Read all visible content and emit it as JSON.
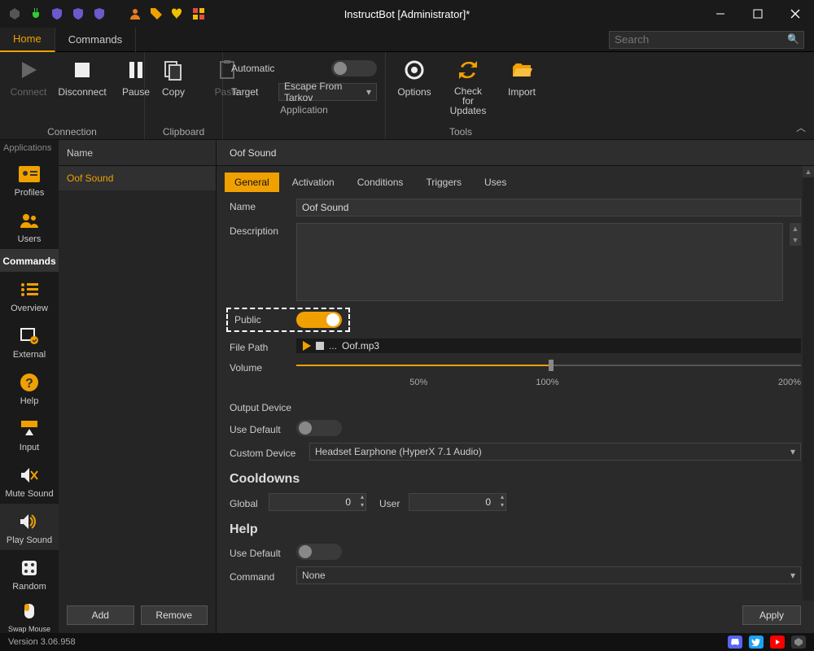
{
  "window": {
    "title": "InstructBot [Administrator]*"
  },
  "toptabs": {
    "items": [
      "Home",
      "Commands"
    ],
    "active": "Home"
  },
  "search": {
    "placeholder": "Search"
  },
  "ribbon": {
    "connection": {
      "label": "Connection",
      "connect": "Connect",
      "disconnect": "Disconnect",
      "pause": "Pause"
    },
    "clipboard": {
      "label": "Clipboard",
      "copy": "Copy",
      "paste": "Paste"
    },
    "application": {
      "label": "Application",
      "automatic": "Automatic",
      "automatic_on": false,
      "target_label": "Target",
      "target_value": "Escape From Tarkov"
    },
    "tools": {
      "label": "Tools",
      "options": "Options",
      "check": "Check for Updates",
      "import": "Import"
    }
  },
  "sidebar": {
    "section": "Applications",
    "items": [
      {
        "label": "Profiles"
      },
      {
        "label": "Users"
      },
      {
        "label": "Commands"
      },
      {
        "label": "Overview"
      },
      {
        "label": "External"
      },
      {
        "label": "Help"
      },
      {
        "label": "Input"
      },
      {
        "label": "Mute Sound"
      },
      {
        "label": "Play Sound"
      },
      {
        "label": "Random"
      },
      {
        "label": "Swap Mouse Button"
      }
    ]
  },
  "col2": {
    "header": "Name",
    "items": [
      "Oof Sound"
    ],
    "add": "Add",
    "remove": "Remove"
  },
  "detail": {
    "title": "Oof Sound",
    "tabs": [
      "General",
      "Activation",
      "Conditions",
      "Triggers",
      "Uses"
    ],
    "active_tab": "General",
    "name_label": "Name",
    "name_value": "Oof Sound",
    "desc_label": "Description",
    "desc_value": "",
    "public_label": "Public",
    "public_on": true,
    "filepath_label": "File Path",
    "filepath_browse": "...",
    "filepath_value": "Oof.mp3",
    "volume_label": "Volume",
    "volume_pct": 100,
    "volume_ticks": [
      "50%",
      "100%",
      "200%"
    ],
    "output_header": "Output Device",
    "usedefault_label": "Use Default",
    "usedefault_on": false,
    "customdev_label": "Custom Device",
    "customdev_value": "Headset Earphone (HyperX 7.1 Audio)",
    "cooldowns_header": "Cooldowns",
    "global_label": "Global",
    "global_value": "0",
    "user_label": "User",
    "user_value": "0",
    "help_header": "Help",
    "help_usedefault_label": "Use Default",
    "help_usedefault_on": false,
    "command_label": "Command",
    "command_value": "None",
    "apply": "Apply"
  },
  "status": {
    "version": "Version 3.06.958"
  },
  "colors": {
    "accent": "#f0a000",
    "discord": "#5865F2",
    "twitter": "#1DA1F2",
    "youtube": "#FF0000"
  }
}
